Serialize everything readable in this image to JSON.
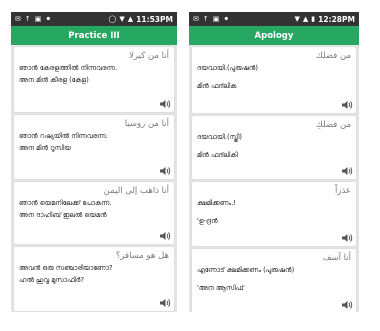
{
  "left": {
    "status": {
      "icons": [
        "✉",
        "↑",
        "▣",
        "⚫"
      ],
      "right_icons": [
        "◯",
        "▼",
        "▲"
      ],
      "time": "11:53PM"
    },
    "title": "Practice III",
    "cards": [
      {
        "arabic": "أنا من كيرلا",
        "line1": "ഞാൻ കേരളത്തിൽ നിന്നവരന്ന.",
        "line2": "അന മിൻ കീരള (കേള)",
        "icon": "speaker-icon"
      },
      {
        "arabic": "أنا من روسيا",
        "line1": "ഞാൻ റഷ്യയിൽ നിന്നവരന്ന.",
        "line2": "അന മിൻ റൂസിയ",
        "icon": "speaker-icon"
      },
      {
        "arabic": "أنا ذاهب إلى اليمن",
        "line1": "ഞാൻ യെമനിലേക്ക് പോകന്ന.",
        "line2": "അന ദാഹിബ് ഇലൽ യെമൻ",
        "icon": "speaker-icon"
      },
      {
        "arabic": "هل هو مسافر؟",
        "line1": "അവൻ ഒരു സഞ്ചാരിയാണോ?",
        "line2": "ഹൽ ഹുവ്വ മുസാഫിർ?",
        "icon": "speaker-icon"
      }
    ]
  },
  "right": {
    "status": {
      "icons": [
        "✉",
        "↑",
        "▣",
        "⚫"
      ],
      "right_icons": [
        "▼",
        "▲",
        "▮"
      ],
      "time": "12:28PM"
    },
    "title": "Apology",
    "cards": [
      {
        "arabic": "من فضلك",
        "line1": "ദയവായി.(പുരുഷൻ)",
        "line2": "മിൻ ഫദ്‌ലിക",
        "icon": "speaker-icon"
      },
      {
        "arabic": "من فضلكِ",
        "line1": "ദയവായി.(സ്ത്രീ)",
        "line2": "മിൻ ഫദ്‌ലികി",
        "icon": "speaker-icon"
      },
      {
        "arabic": "عذراً",
        "line1": "ക്ഷമിക്കണം.!",
        "line2": "'ഉ-ദ്രൻ",
        "icon": "speaker-icon"
      },
      {
        "arabic": "أنا آسف",
        "line1": "എന്നോട് ക്ഷമിക്കണം (പുരുഷൻ)",
        "line2": "'അന ആസിഫ്",
        "icon": "speaker-icon"
      }
    ]
  },
  "colors": {
    "app_bar": "#26a863",
    "status_bar": "#333333",
    "background": "#e4e4e4"
  }
}
